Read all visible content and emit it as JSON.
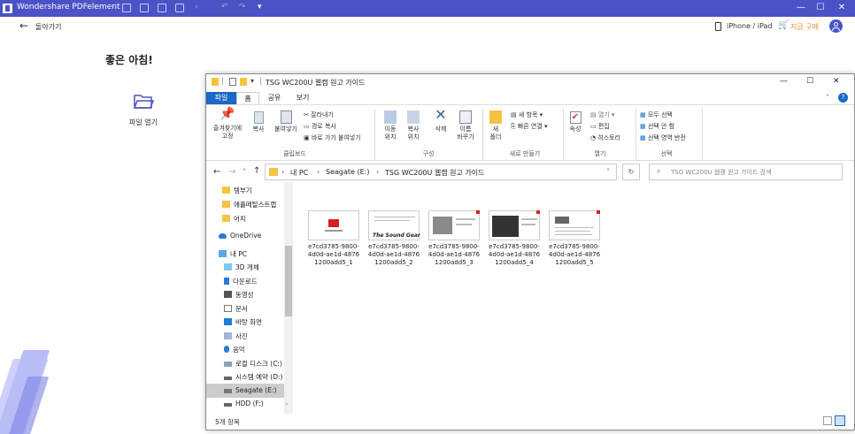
{
  "app": {
    "title": "Wondershare PDFelement",
    "device": "iPhone / iPad",
    "buy": "지금 구매"
  },
  "nav": {
    "back": "돌아가기"
  },
  "home": {
    "greeting": "좋은 아침!",
    "open_file": "파일 열기"
  },
  "explorer": {
    "title": "TSG WC200U 웹캠 원고 가이드",
    "tabs": [
      "파일",
      "홈",
      "공유",
      "보기"
    ],
    "ribbon": {
      "pin": "즐겨찾기에\n고정",
      "copy": "복사",
      "paste": "붙여넣기",
      "cut": "잘라내기",
      "copy_path": "경로 복사",
      "paste_shortcut": "바로 가기 붙여넣기",
      "move": "이동\n위치",
      "copyto": "복사\n위치",
      "delete": "삭제",
      "rename": "이름\n바꾸기",
      "new_folder": "새\n폴더",
      "new_item": "새 항목",
      "easy_access": "빠른 연결",
      "properties": "속성",
      "open": "열기",
      "edit": "편집",
      "history": "히스토리",
      "select_all": "모두 선택",
      "select_none": "선택 안 함",
      "invert": "선택 영역 반전",
      "groups": [
        "클립보드",
        "구성",
        "새로 만들기",
        "열기",
        "선택"
      ]
    },
    "breadcrumb": [
      "내 PC",
      "Seagate (E:)",
      "TSG WC200U 웹캠 원고 가이드"
    ],
    "search_placeholder": "TSG WC200U 웹캠 원고 가이드 검색",
    "sidebar": [
      "템부기",
      "애플메탈스트랩",
      "어치",
      "OneDrive",
      "내 PC",
      "3D 개체",
      "다운로드",
      "동영상",
      "문서",
      "바탕 화면",
      "사진",
      "음악",
      "로컬 디스크 (C:)",
      "시스템 예약 (D:)",
      "Seagate (E:)",
      "HDD (F:)"
    ],
    "files": [
      {
        "line1": "e7cd3785-9800-",
        "line2": "4d0d-ae1d-4876",
        "line3": "1200add5_1"
      },
      {
        "line1": "e7cd3785-9800-",
        "line2": "4d0d-ae1d-4876",
        "line3": "1200add5_2"
      },
      {
        "line1": "e7cd3785-9800-",
        "line2": "4d0d-ae1d-4876",
        "line3": "1200add5_3"
      },
      {
        "line1": "e7cd3785-9800-",
        "line2": "4d0d-ae1d-4876",
        "line3": "1200add5_4"
      },
      {
        "line1": "e7cd3785-9800-",
        "line2": "4d0d-ae1d-4876",
        "line3": "1200add5_5"
      }
    ],
    "thumb2_text": "The Sound Gear",
    "status": "5개 항목"
  }
}
